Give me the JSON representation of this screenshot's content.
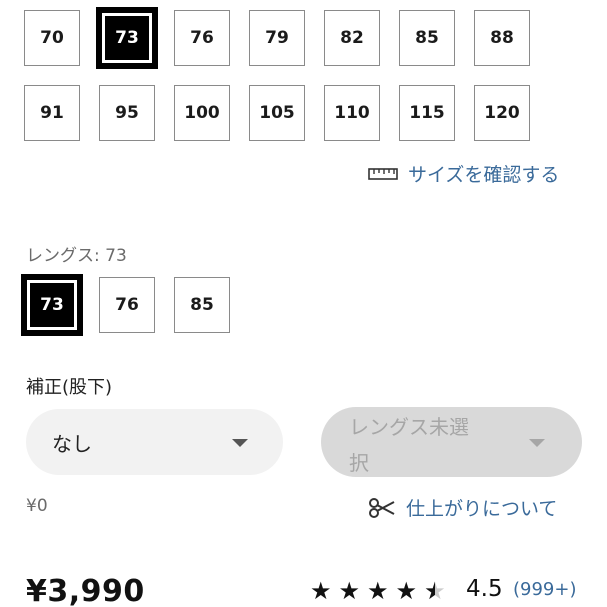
{
  "waist_sizes": [
    {
      "label": "70",
      "selected": false
    },
    {
      "label": "73",
      "selected": true
    },
    {
      "label": "76",
      "selected": false
    },
    {
      "label": "79",
      "selected": false
    },
    {
      "label": "82",
      "selected": false
    },
    {
      "label": "85",
      "selected": false
    },
    {
      "label": "88",
      "selected": false
    },
    {
      "label": "91",
      "selected": false
    },
    {
      "label": "95",
      "selected": false
    },
    {
      "label": "100",
      "selected": false
    },
    {
      "label": "105",
      "selected": false
    },
    {
      "label": "110",
      "selected": false
    },
    {
      "label": "115",
      "selected": false
    },
    {
      "label": "120",
      "selected": false
    }
  ],
  "size_guide_link": "サイズを確認する",
  "length": {
    "label": "レングス: 73",
    "options": [
      {
        "label": "73",
        "selected": true
      },
      {
        "label": "76",
        "selected": false
      },
      {
        "label": "85",
        "selected": false
      }
    ]
  },
  "hemming": {
    "label": "補正(股下)",
    "select_value": "なし",
    "disabled_select_line1": "レングス未選",
    "disabled_select_line2": "択",
    "price": "¥0",
    "finish_link": "仕上がりについて"
  },
  "product": {
    "price": "¥3,990",
    "rating": "4.5",
    "review_count": "(999+)"
  },
  "colors": {
    "link": "#3a6a9a",
    "select_bg": "#f2f2f2",
    "disabled_bg": "#d9d9d9",
    "disabled_text": "#a6a6a6"
  },
  "icons": {
    "ruler": "ruler-icon",
    "scissors": "scissors-icon",
    "caret": "chevron-down-icon",
    "star": "star-icon"
  }
}
